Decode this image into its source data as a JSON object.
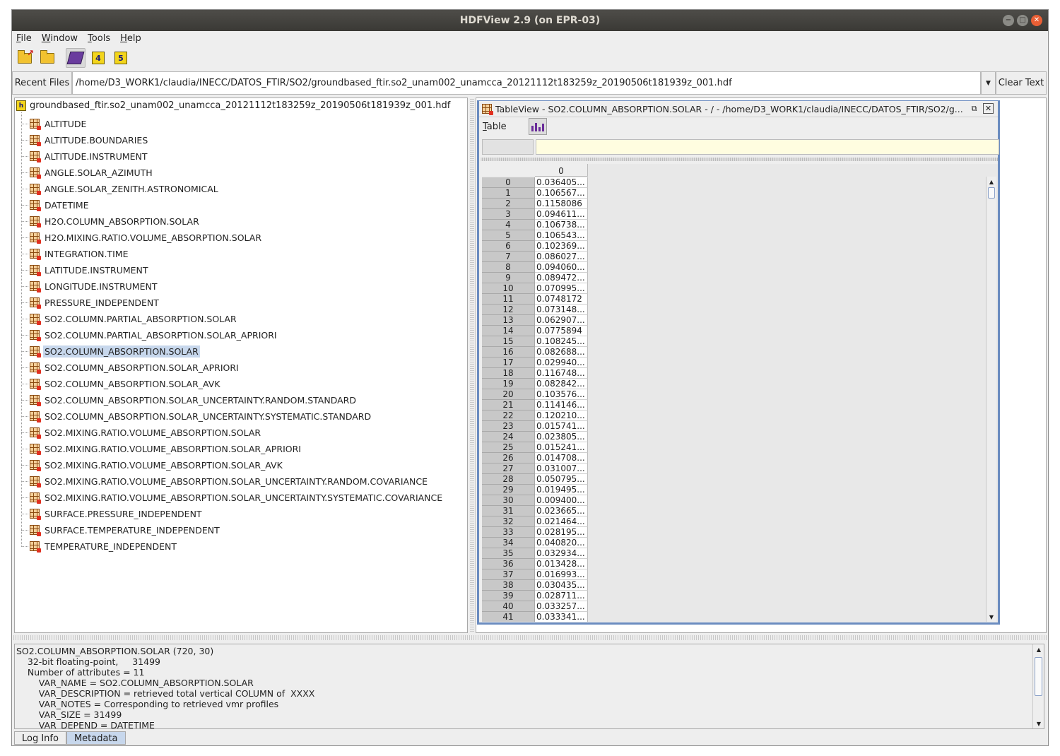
{
  "window": {
    "title": "HDFView 2.9 (on EPR-03)",
    "controls": [
      "−",
      "□",
      "✕"
    ]
  },
  "menu": {
    "items": [
      {
        "pre": "",
        "ul": "F",
        "post": "ile"
      },
      {
        "pre": "",
        "ul": "W",
        "post": "indow"
      },
      {
        "pre": "",
        "ul": "T",
        "post": "ools"
      },
      {
        "pre": "",
        "ul": "H",
        "post": "elp"
      }
    ]
  },
  "toolbar": {
    "icons": [
      "open-file-icon",
      "open-folder-icon",
      "users-guide-icon",
      "hdf4-library-icon",
      "hdf5-library-icon"
    ],
    "h4": "4",
    "h5": "5"
  },
  "pathbar": {
    "recent_label": "Recent Files",
    "path": "/home/D3_WORK1/claudia/INECC/DATOS_FTIR/SO2/groundbased_ftir.so2_unam002_unamcca_20121112t183259z_20190506t181939z_001.hdf",
    "clear_label": "Clear Text"
  },
  "tree": {
    "root": "groundbased_ftir.so2_unam002_unamcca_20121112t183259z_20190506t181939z_001.hdf",
    "root_icon": "h",
    "items": [
      "ALTITUDE",
      "ALTITUDE.BOUNDARIES",
      "ALTITUDE.INSTRUMENT",
      "ANGLE.SOLAR_AZIMUTH",
      "ANGLE.SOLAR_ZENITH.ASTRONOMICAL",
      "DATETIME",
      "H2O.COLUMN_ABSORPTION.SOLAR",
      "H2O.MIXING.RATIO.VOLUME_ABSORPTION.SOLAR",
      "INTEGRATION.TIME",
      "LATITUDE.INSTRUMENT",
      "LONGITUDE.INSTRUMENT",
      "PRESSURE_INDEPENDENT",
      "SO2.COLUMN.PARTIAL_ABSORPTION.SOLAR",
      "SO2.COLUMN.PARTIAL_ABSORPTION.SOLAR_APRIORI",
      "SO2.COLUMN_ABSORPTION.SOLAR",
      "SO2.COLUMN_ABSORPTION.SOLAR_APRIORI",
      "SO2.COLUMN_ABSORPTION.SOLAR_AVK",
      "SO2.COLUMN_ABSORPTION.SOLAR_UNCERTAINTY.RANDOM.STANDARD",
      "SO2.COLUMN_ABSORPTION.SOLAR_UNCERTAINTY.SYSTEMATIC.STANDARD",
      "SO2.MIXING.RATIO.VOLUME_ABSORPTION.SOLAR",
      "SO2.MIXING.RATIO.VOLUME_ABSORPTION.SOLAR_APRIORI",
      "SO2.MIXING.RATIO.VOLUME_ABSORPTION.SOLAR_AVK",
      "SO2.MIXING.RATIO.VOLUME_ABSORPTION.SOLAR_UNCERTAINTY.RANDOM.COVARIANCE",
      "SO2.MIXING.RATIO.VOLUME_ABSORPTION.SOLAR_UNCERTAINTY.SYSTEMATIC.COVARIANCE",
      "SURFACE.PRESSURE_INDEPENDENT",
      "SURFACE.TEMPERATURE_INDEPENDENT",
      "TEMPERATURE_INDEPENDENT"
    ],
    "selected": "SO2.COLUMN_ABSORPTION.SOLAR"
  },
  "tableview": {
    "title": "TableView  -  SO2.COLUMN_ABSORPTION.SOLAR  -  /  -  /home/D3_WORK1/claudia/INECC/DATOS_FTIR/SO2/g...",
    "menu_pre": "",
    "menu_ul": "T",
    "menu_post": "able",
    "column_header": "0",
    "rows": [
      "0.036405...",
      "0.106567...",
      "0.1158086",
      "0.094611...",
      "0.106738...",
      "0.106543...",
      "0.102369...",
      "0.086027...",
      "0.094060...",
      "0.089472...",
      "0.070995...",
      "0.0748172",
      "0.073148...",
      "0.062907...",
      "0.0775894",
      "0.108245...",
      "0.082688...",
      "0.029940...",
      "0.116748...",
      "0.082842...",
      "0.103576...",
      "0.114146...",
      "0.120210...",
      "0.015741...",
      "0.023805...",
      "0.015241...",
      "0.014708...",
      "0.031007...",
      "0.050795...",
      "0.019495...",
      "0.009400...",
      "0.023665...",
      "0.021464...",
      "0.028195...",
      "0.040820...",
      "0.032934...",
      "0.013428...",
      "0.016993...",
      "0.030435...",
      "0.028711...",
      "0.033257...",
      "0.033341..."
    ]
  },
  "metadata": {
    "lines": [
      "SO2.COLUMN_ABSORPTION.SOLAR (720, 30)",
      "    32-bit floating-point,     31499",
      "    Number of attributes = 11",
      "        VAR_NAME = SO2.COLUMN_ABSORPTION.SOLAR",
      "        VAR_DESCRIPTION = retrieved total vertical COLUMN of  XXXX",
      "        VAR_NOTES = Corresponding to retrieved vmr profiles",
      "        VAR_SIZE = 31499",
      "        VAR_DEPEND = DATETIME"
    ]
  },
  "tabs": [
    {
      "label": "Log Info",
      "active": false
    },
    {
      "label": "Metadata",
      "active": true
    }
  ],
  "colors": {
    "titlebar": "#3c3b37",
    "selection": "#c7d7ec",
    "tableview_border": "#6b8cc0",
    "cell_editor": "#fffde0"
  }
}
